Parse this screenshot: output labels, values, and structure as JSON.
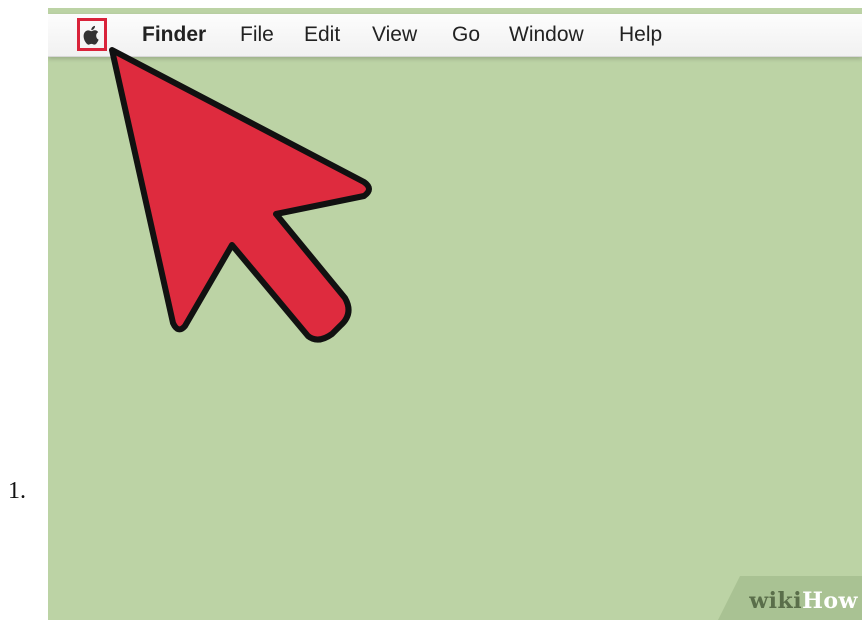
{
  "step": {
    "number": "1."
  },
  "menubar": {
    "apple_icon": "apple-logo",
    "items": [
      {
        "label": "Finder",
        "bold": true
      },
      {
        "label": "File"
      },
      {
        "label": "Edit"
      },
      {
        "label": "View"
      },
      {
        "label": "Go"
      },
      {
        "label": "Window"
      },
      {
        "label": "Help"
      }
    ]
  },
  "pointer": {
    "icon": "cursor-arrow-icon",
    "color": "#de2b3e"
  },
  "colors": {
    "desktop": "#bcd3a5",
    "highlight": "#d9233a"
  },
  "watermark": {
    "wiki": "wiki",
    "how": "How"
  }
}
